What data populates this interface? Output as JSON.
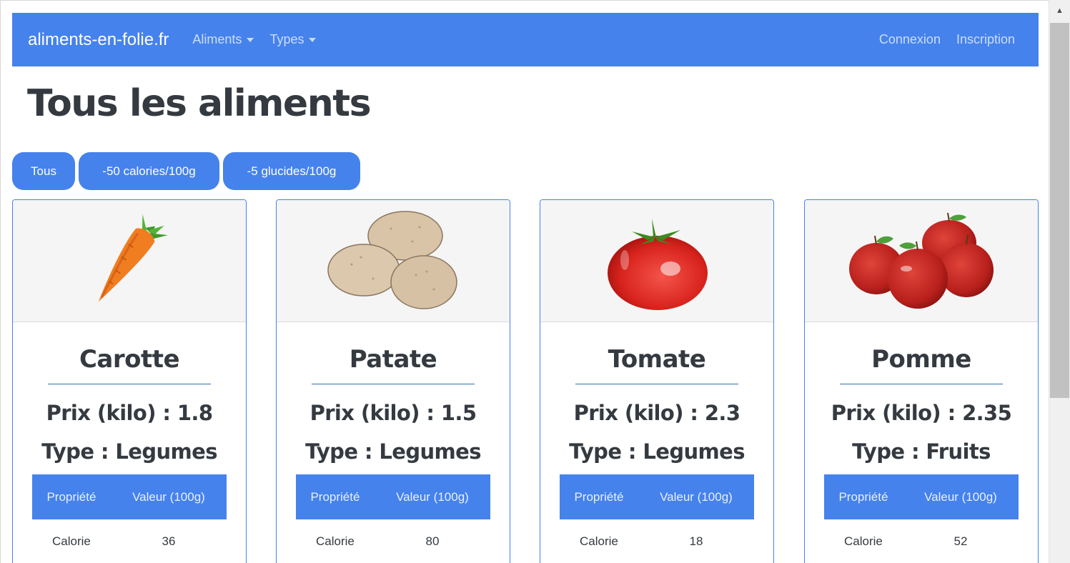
{
  "navbar": {
    "brand": "aliments-en-folie.fr",
    "menus": [
      {
        "label": "Aliments"
      },
      {
        "label": "Types"
      }
    ],
    "right_links": [
      {
        "label": "Connexion"
      },
      {
        "label": "Inscription"
      }
    ]
  },
  "page": {
    "title": "Tous les aliments"
  },
  "filters": [
    {
      "label": "Tous"
    },
    {
      "label": "-50 calories/100g"
    },
    {
      "label": "-5 glucides/100g"
    }
  ],
  "table_headers": {
    "property": "Propriété",
    "value": "Valeur (100g)"
  },
  "foods": [
    {
      "name": "Carotte",
      "price": "Prix (kilo) : 1.8",
      "type": "Type : Legumes",
      "image_icon": "carrot-image",
      "rows": [
        {
          "property": "Calorie",
          "value": "36"
        }
      ]
    },
    {
      "name": "Patate",
      "price": "Prix (kilo) : 1.5",
      "type": "Type : Legumes",
      "image_icon": "potato-image",
      "rows": [
        {
          "property": "Calorie",
          "value": "80"
        }
      ]
    },
    {
      "name": "Tomate",
      "price": "Prix (kilo) : 2.3",
      "type": "Type : Legumes",
      "image_icon": "tomato-image",
      "rows": [
        {
          "property": "Calorie",
          "value": "18"
        }
      ]
    },
    {
      "name": "Pomme",
      "price": "Prix (kilo) : 2.35",
      "type": "Type : Fruits",
      "image_icon": "apple-image",
      "rows": [
        {
          "property": "Calorie",
          "value": "52"
        }
      ]
    }
  ],
  "colors": {
    "primary": "#4582ec",
    "text": "#343a40",
    "image_background": "#f5f5f5"
  }
}
